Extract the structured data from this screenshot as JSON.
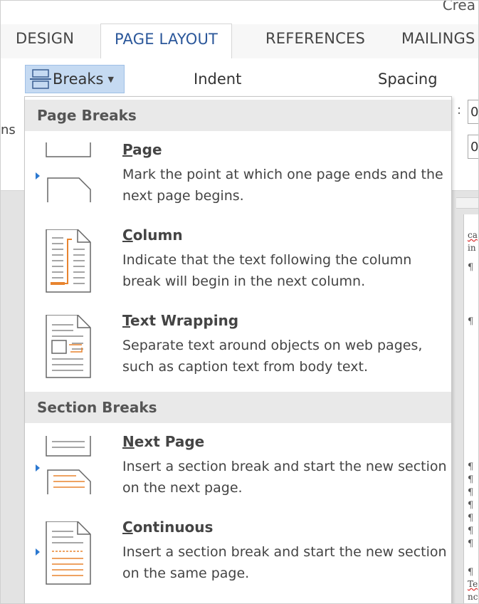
{
  "window": {
    "title_fragment": "Crea"
  },
  "tabs": [
    {
      "label": "DESIGN",
      "active": false
    },
    {
      "label": "PAGE LAYOUT",
      "active": true
    },
    {
      "label": "REFERENCES",
      "active": false
    },
    {
      "label": "MAILINGS",
      "active": false
    }
  ],
  "ribbon": {
    "breaks_label": "Breaks",
    "indent_label": "Indent",
    "spacing_label": "Spacing",
    "left_edge_text": "ns",
    "spin1_value": "0",
    "spin2_value": "0",
    "colon": ":"
  },
  "menu": {
    "page_breaks_header": "Page Breaks",
    "section_breaks_header": "Section Breaks",
    "items": [
      {
        "title_u": "P",
        "title_rest": "age",
        "desc": "Mark the point at which one page ends and the next page begins.",
        "icon": "page-break-icon"
      },
      {
        "title_u": "C",
        "title_rest": "olumn",
        "desc": "Indicate that the text following the column break will begin in the next column.",
        "icon": "column-break-icon"
      },
      {
        "title_u": "T",
        "title_rest": "ext Wrapping",
        "desc": "Separate text around objects on web pages, such as caption text from body text.",
        "icon": "text-wrapping-icon"
      },
      {
        "title_u": "N",
        "title_rest": "ext Page",
        "desc": "Insert a section break and start the new section on the next page.",
        "icon": "next-page-icon"
      },
      {
        "title_u": "C",
        "title_rest": "ontinuous",
        "desc": "Insert a section break and start the new section on the same page.",
        "icon": "continuous-icon"
      }
    ]
  },
  "document": {
    "pilcrow": "¶",
    "snippet_a": "ca",
    "snippet_b": "in",
    "snippet_c": "Te",
    "snippet_d": "nc"
  },
  "colors": {
    "accent": "#2b579a",
    "highlight": "#c5daf2",
    "orange": "#e8842f",
    "marker": "#2b78d0"
  }
}
